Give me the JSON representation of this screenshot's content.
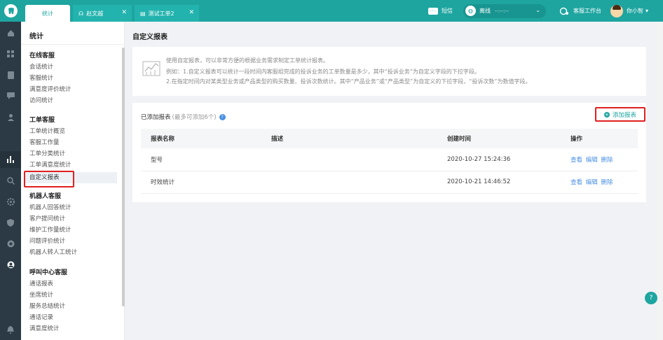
{
  "tabs": [
    {
      "label": "统计"
    },
    {
      "label": "赵文越"
    },
    {
      "label": "测试工单2"
    }
  ],
  "header": {
    "message_label": "短信",
    "status_label": "离线",
    "status_timer": "--:--:--",
    "workbench_label": "客服工作台",
    "user_name": "你小智"
  },
  "sidebar": {
    "title": "统计",
    "groups": [
      {
        "label": "在线客服",
        "items": [
          "会话统计",
          "客服统计",
          "满意度评价统计",
          "访问统计"
        ]
      },
      {
        "label": "工单客服",
        "items": [
          "工单统计概览",
          "客服工作量",
          "工单分类统计",
          "工单满意度统计",
          "自定义报表"
        ]
      },
      {
        "label": "机器人客服",
        "items": [
          "机器人回答统计",
          "客户提问统计",
          "维护工作量统计",
          "问题评价统计",
          "机器人转人工统计"
        ]
      },
      {
        "label": "呼叫中心客服",
        "items": [
          "通话报表",
          "坐席统计",
          "服务总结统计",
          "通话记录",
          "满意度统计"
        ]
      }
    ]
  },
  "main": {
    "title": "自定义报表",
    "tips": [
      "使用自定报表，可以非常方便的根据业务需求制定工单统计报表。",
      "例如：1.自定义报表可以统计一段时间内客服组完成的投诉业务的工单数量是多少，其中“投诉业务”为自定义字段的下拉字段。",
      "2.在指定时间内对某类型业务或产品类型的购买数量、投诉次数统计。其中“产品业务”或“产品类型”为自定义的下拉字段，“投诉次数”为数值字段。"
    ],
    "card_title": "已添加报表",
    "card_hint": "(最多可添加6个)",
    "add_button": "添加报表",
    "columns": [
      "报表名称",
      "描述",
      "创建时间",
      "操作"
    ],
    "rows": [
      {
        "name": "型号",
        "desc": "",
        "created": "2020-10-27 15:24:36"
      },
      {
        "name": "时效统计",
        "desc": "",
        "created": "2020-10-21 14:46:52"
      }
    ],
    "ops": [
      "查看",
      "编辑",
      "删除"
    ]
  },
  "colors": {
    "brand": "#1ea5a0",
    "rail": "#2b3a45",
    "highlight": "#e02020",
    "link": "#4a90e2"
  }
}
